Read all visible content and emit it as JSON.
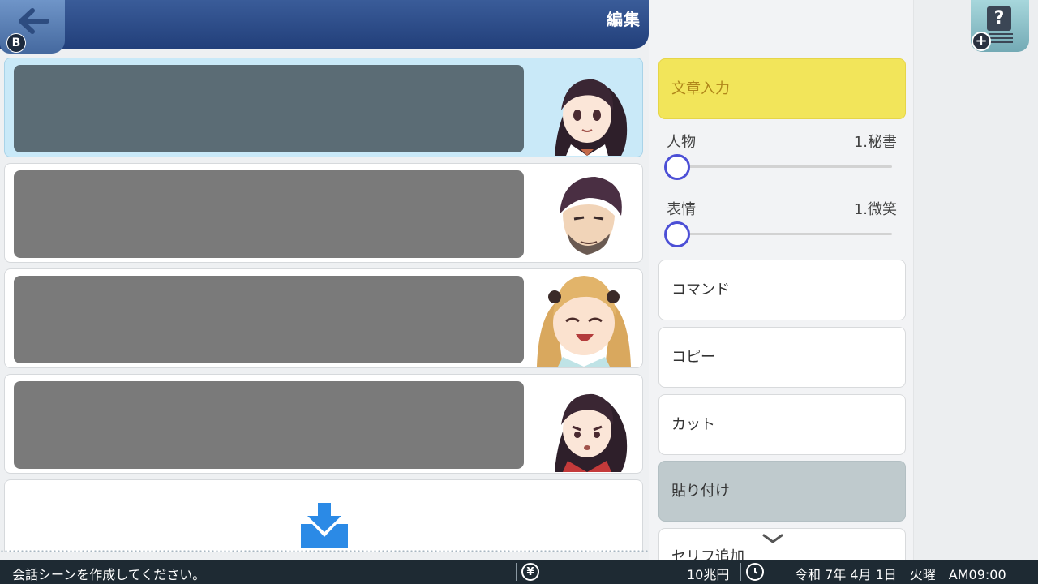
{
  "header": {
    "title": "編集",
    "back_button_badge": "B",
    "back_icon": "arrow-left-icon"
  },
  "help": {
    "icon": "question-help-icon",
    "glyph": "?",
    "plus": "+"
  },
  "dialog_rows": [
    {
      "selected": true,
      "portrait": "secretary-smile-portrait"
    },
    {
      "selected": false,
      "portrait": "bearded-man-portrait"
    },
    {
      "selected": false,
      "portrait": "twin-tail-girl-laughing-portrait"
    },
    {
      "selected": false,
      "portrait": "secretary-troubled-portrait"
    }
  ],
  "add_row": {
    "icon": "download-icon"
  },
  "side_panel": {
    "text_input_label": "文章入力",
    "person_label": "人物",
    "person_value": "1.秘書",
    "expression_label": "表情",
    "expression_value": "1.微笑",
    "command_label": "コマンド",
    "copy_label": "コピー",
    "cut_label": "カット",
    "paste_label": "貼り付け",
    "add_line_label": "セリフ追加"
  },
  "status": {
    "message": "会話シーンを作成してください。",
    "currency_icon": "¥",
    "money": "10兆円",
    "date": "令和 7年 4月 1日　火曜　AM09:00"
  },
  "colors": {
    "header": "#223f7a",
    "primary_button": "#f2e55a",
    "paste_button": "#bfcacd",
    "selected_row": "#c9e9f8",
    "slider_knob": "#4c4fd6",
    "status_bar": "#1e2a33"
  }
}
